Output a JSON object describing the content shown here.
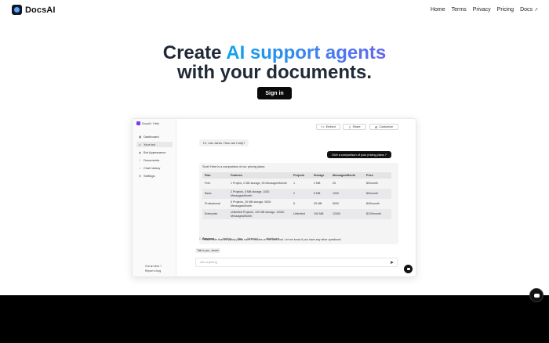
{
  "nav": {
    "brand": "DocsAI",
    "links": [
      "Home",
      "Terms",
      "Privacy",
      "Pricing",
      "Docs"
    ],
    "docs_external_icon": "external-link-icon"
  },
  "hero": {
    "line1_a": "Create ",
    "line1_b": "AI support agents",
    "line2": "with your documents.",
    "cta": "Sign in"
  },
  "preview": {
    "breadcrumb": "DocsAI / Hello",
    "sidebar": [
      {
        "label": "Dashboard",
        "icon": "dashboard-icon"
      },
      {
        "label": "Your bot",
        "icon": "bot-icon"
      },
      {
        "label": "Bot Appearance",
        "icon": "palette-icon"
      },
      {
        "label": "Documents",
        "icon": "document-icon"
      },
      {
        "label": "Chat history",
        "icon": "chat-icon"
      },
      {
        "label": "Settings",
        "icon": "gear-icon"
      }
    ],
    "sidebar_footer": [
      "Got an idea ?",
      "Report a bug"
    ],
    "toolbar": {
      "embed": "Embed",
      "share": "Share",
      "customize": "Customize"
    },
    "bot_greeting": "Hi, I am Jarvis. How can I help?",
    "user_message": "Give a comparison of your pricing plans ?",
    "answer_intro": "Sure! Here is a comparison of our pricing plans:",
    "table": {
      "headers": [
        "Plan",
        "Features",
        "Projects",
        "Storage",
        "Messages/Month",
        "Price"
      ],
      "rows": [
        [
          "Free",
          "1 Project, 2 MB storage, 25 Messages/Month",
          "1",
          "2 MB",
          "25",
          "$0/month"
        ],
        [
          "Basic",
          "2 Projects, 5 MB storage, 1000 Messages/Month",
          "2",
          "5 MB",
          "1000",
          "$9/month"
        ],
        [
          "Professional",
          "5 Projects, 25 MB storage, 5000 Messages/Month",
          "5",
          "25 MB",
          "5000",
          "$49/month"
        ],
        [
          "Enterprise",
          "Unlimited Projects, 100 MB storage, 12000 Messages/Month",
          "Unlimited",
          "100 MB",
          "12000",
          "$129/month"
        ]
      ]
    },
    "answer_note": "Please note that the yearly plans save 2 months on the total cost. Let me know if you have any other questions!",
    "sources_label": "Sources",
    "sources": [
      "/pricing",
      "/faq",
      "/docs/api",
      "/dashboard"
    ],
    "jarvis_chip": "Talk to you, Jarvis!",
    "ask_placeholder": "Ask anything"
  }
}
